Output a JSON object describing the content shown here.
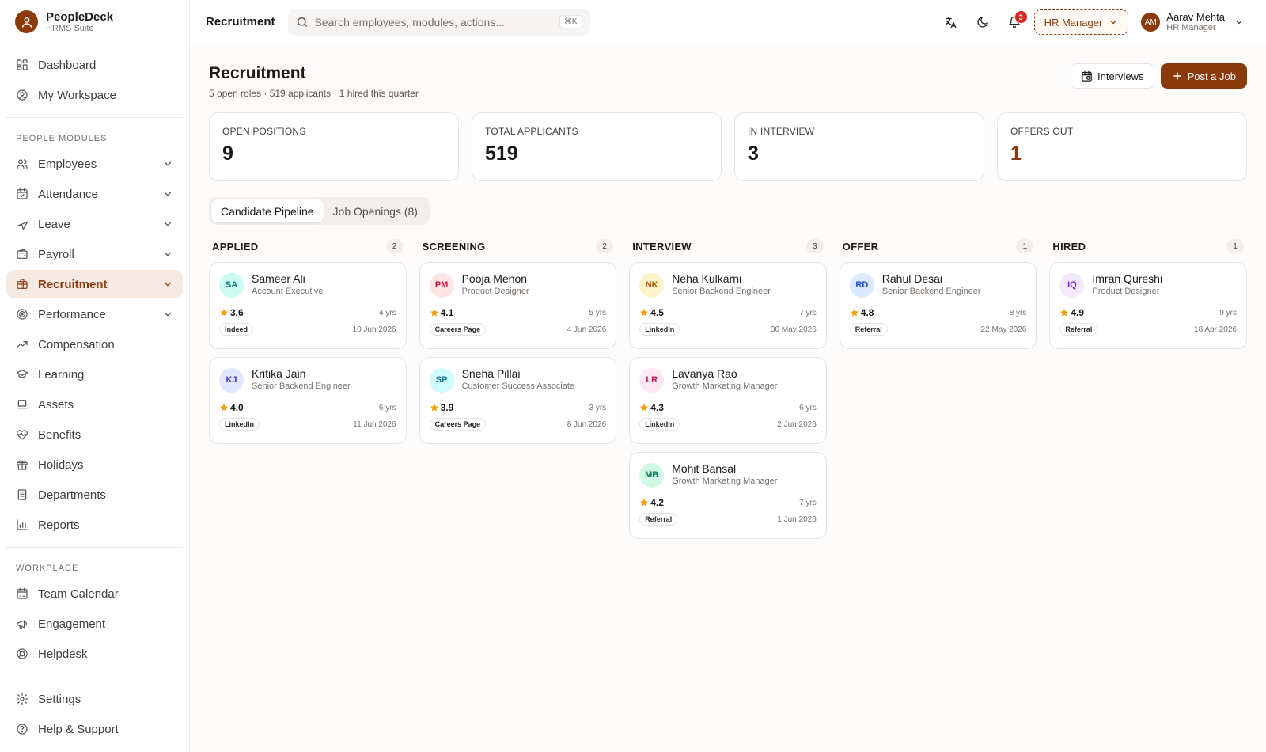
{
  "brand": {
    "name": "PeopleDeck",
    "subtitle": "HRMS Suite"
  },
  "sidebar": {
    "top_items": [
      {
        "label": "Dashboard",
        "icon": "grid-icon"
      },
      {
        "label": "My Workspace",
        "icon": "user-circle-icon"
      }
    ],
    "section_people": "PEOPLE MODULES",
    "people_items": [
      {
        "label": "Employees",
        "icon": "users-icon",
        "expandable": true
      },
      {
        "label": "Attendance",
        "icon": "calendar-check-icon",
        "expandable": true
      },
      {
        "label": "Leave",
        "icon": "plane-icon",
        "expandable": true
      },
      {
        "label": "Payroll",
        "icon": "wallet-icon",
        "expandable": true
      },
      {
        "label": "Recruitment",
        "icon": "briefcase-icon",
        "expandable": true,
        "active": true
      },
      {
        "label": "Performance",
        "icon": "target-icon",
        "expandable": true
      },
      {
        "label": "Compensation",
        "icon": "trending-up-icon"
      },
      {
        "label": "Learning",
        "icon": "graduation-cap-icon"
      },
      {
        "label": "Assets",
        "icon": "laptop-icon"
      },
      {
        "label": "Benefits",
        "icon": "heart-pulse-icon"
      },
      {
        "label": "Holidays",
        "icon": "gift-icon"
      },
      {
        "label": "Departments",
        "icon": "building-icon"
      },
      {
        "label": "Reports",
        "icon": "bar-chart-icon"
      }
    ],
    "section_workplace": "WORKPLACE",
    "workplace_items": [
      {
        "label": "Team Calendar",
        "icon": "calendar-icon"
      },
      {
        "label": "Engagement",
        "icon": "megaphone-icon"
      },
      {
        "label": "Helpdesk",
        "icon": "lifebuoy-icon"
      }
    ],
    "bottom_items": [
      {
        "label": "Settings",
        "icon": "gear-icon"
      },
      {
        "label": "Help & Support",
        "icon": "help-circle-icon"
      }
    ]
  },
  "topbar": {
    "title": "Recruitment",
    "search_placeholder": "Search employees, modules, actions...",
    "search_shortcut": "⌘K",
    "notifications_count": "3",
    "role": "HR Manager",
    "user": {
      "initials": "AM",
      "name": "Aarav Mehta",
      "role": "HR Manager"
    }
  },
  "page": {
    "title": "Recruitment",
    "subtitle": "5 open roles · 519 applicants · 1 hired this quarter",
    "interviews_button": "Interviews",
    "post_job_button": "Post a Job"
  },
  "stats": [
    {
      "label": "OPEN POSITIONS",
      "value": "9"
    },
    {
      "label": "TOTAL APPLICANTS",
      "value": "519"
    },
    {
      "label": "IN INTERVIEW",
      "value": "3"
    },
    {
      "label": "OFFERS OUT",
      "value": "1",
      "accent": true
    }
  ],
  "tabs": [
    {
      "label": "Candidate Pipeline",
      "active": true
    },
    {
      "label": "Job Openings (8)",
      "active": false
    }
  ],
  "pipeline": [
    {
      "title": "APPLIED",
      "count": "2",
      "cards": [
        {
          "initials": "SA",
          "name": "Sameer Ali",
          "role": "Account Executive",
          "rating": "3.6",
          "exp": "4 yrs",
          "source": "Indeed",
          "date": "10 Jun 2026",
          "bg": "#ccfbf1",
          "fg": "#0f766e"
        },
        {
          "initials": "KJ",
          "name": "Kritika Jain",
          "role": "Senior Backend Engineer",
          "rating": "4.0",
          "exp": "6 yrs",
          "source": "LinkedIn",
          "date": "11 Jun 2026",
          "bg": "#e0e7ff",
          "fg": "#4338ca"
        }
      ]
    },
    {
      "title": "SCREENING",
      "count": "2",
      "cards": [
        {
          "initials": "PM",
          "name": "Pooja Menon",
          "role": "Product Designer",
          "rating": "4.1",
          "exp": "5 yrs",
          "source": "Careers Page",
          "date": "4 Jun 2026",
          "bg": "#ffe4e6",
          "fg": "#be123c"
        },
        {
          "initials": "SP",
          "name": "Sneha Pillai",
          "role": "Customer Success Associate",
          "rating": "3.9",
          "exp": "3 yrs",
          "source": "Careers Page",
          "date": "8 Jun 2026",
          "bg": "#cffafe",
          "fg": "#0e7490"
        }
      ]
    },
    {
      "title": "INTERVIEW",
      "count": "3",
      "cards": [
        {
          "initials": "NK",
          "name": "Neha Kulkarni",
          "role": "Senior Backend Engineer",
          "rating": "4.5",
          "exp": "7 yrs",
          "source": "LinkedIn",
          "date": "30 May 2026",
          "bg": "#fef3c7",
          "fg": "#b45309"
        },
        {
          "initials": "LR",
          "name": "Lavanya Rao",
          "role": "Growth Marketing Manager",
          "rating": "4.3",
          "exp": "6 yrs",
          "source": "LinkedIn",
          "date": "2 Jun 2026",
          "bg": "#fce7f3",
          "fg": "#be185d"
        },
        {
          "initials": "MB",
          "name": "Mohit Bansal",
          "role": "Growth Marketing Manager",
          "rating": "4.2",
          "exp": "7 yrs",
          "source": "Referral",
          "date": "1 Jun 2026",
          "bg": "#d1fae5",
          "fg": "#047857"
        }
      ]
    },
    {
      "title": "OFFER",
      "count": "1",
      "cards": [
        {
          "initials": "RD",
          "name": "Rahul Desai",
          "role": "Senior Backend Engineer",
          "rating": "4.8",
          "exp": "8 yrs",
          "source": "Referral",
          "date": "22 May 2026",
          "bg": "#dbeafe",
          "fg": "#1d4ed8"
        }
      ]
    },
    {
      "title": "HIRED",
      "count": "1",
      "cards": [
        {
          "initials": "IQ",
          "name": "Imran Qureshi",
          "role": "Product Designer",
          "rating": "4.9",
          "exp": "9 yrs",
          "source": "Referral",
          "date": "18 Apr 2026",
          "bg": "#f3e8ff",
          "fg": "#7e22ce"
        }
      ]
    }
  ]
}
